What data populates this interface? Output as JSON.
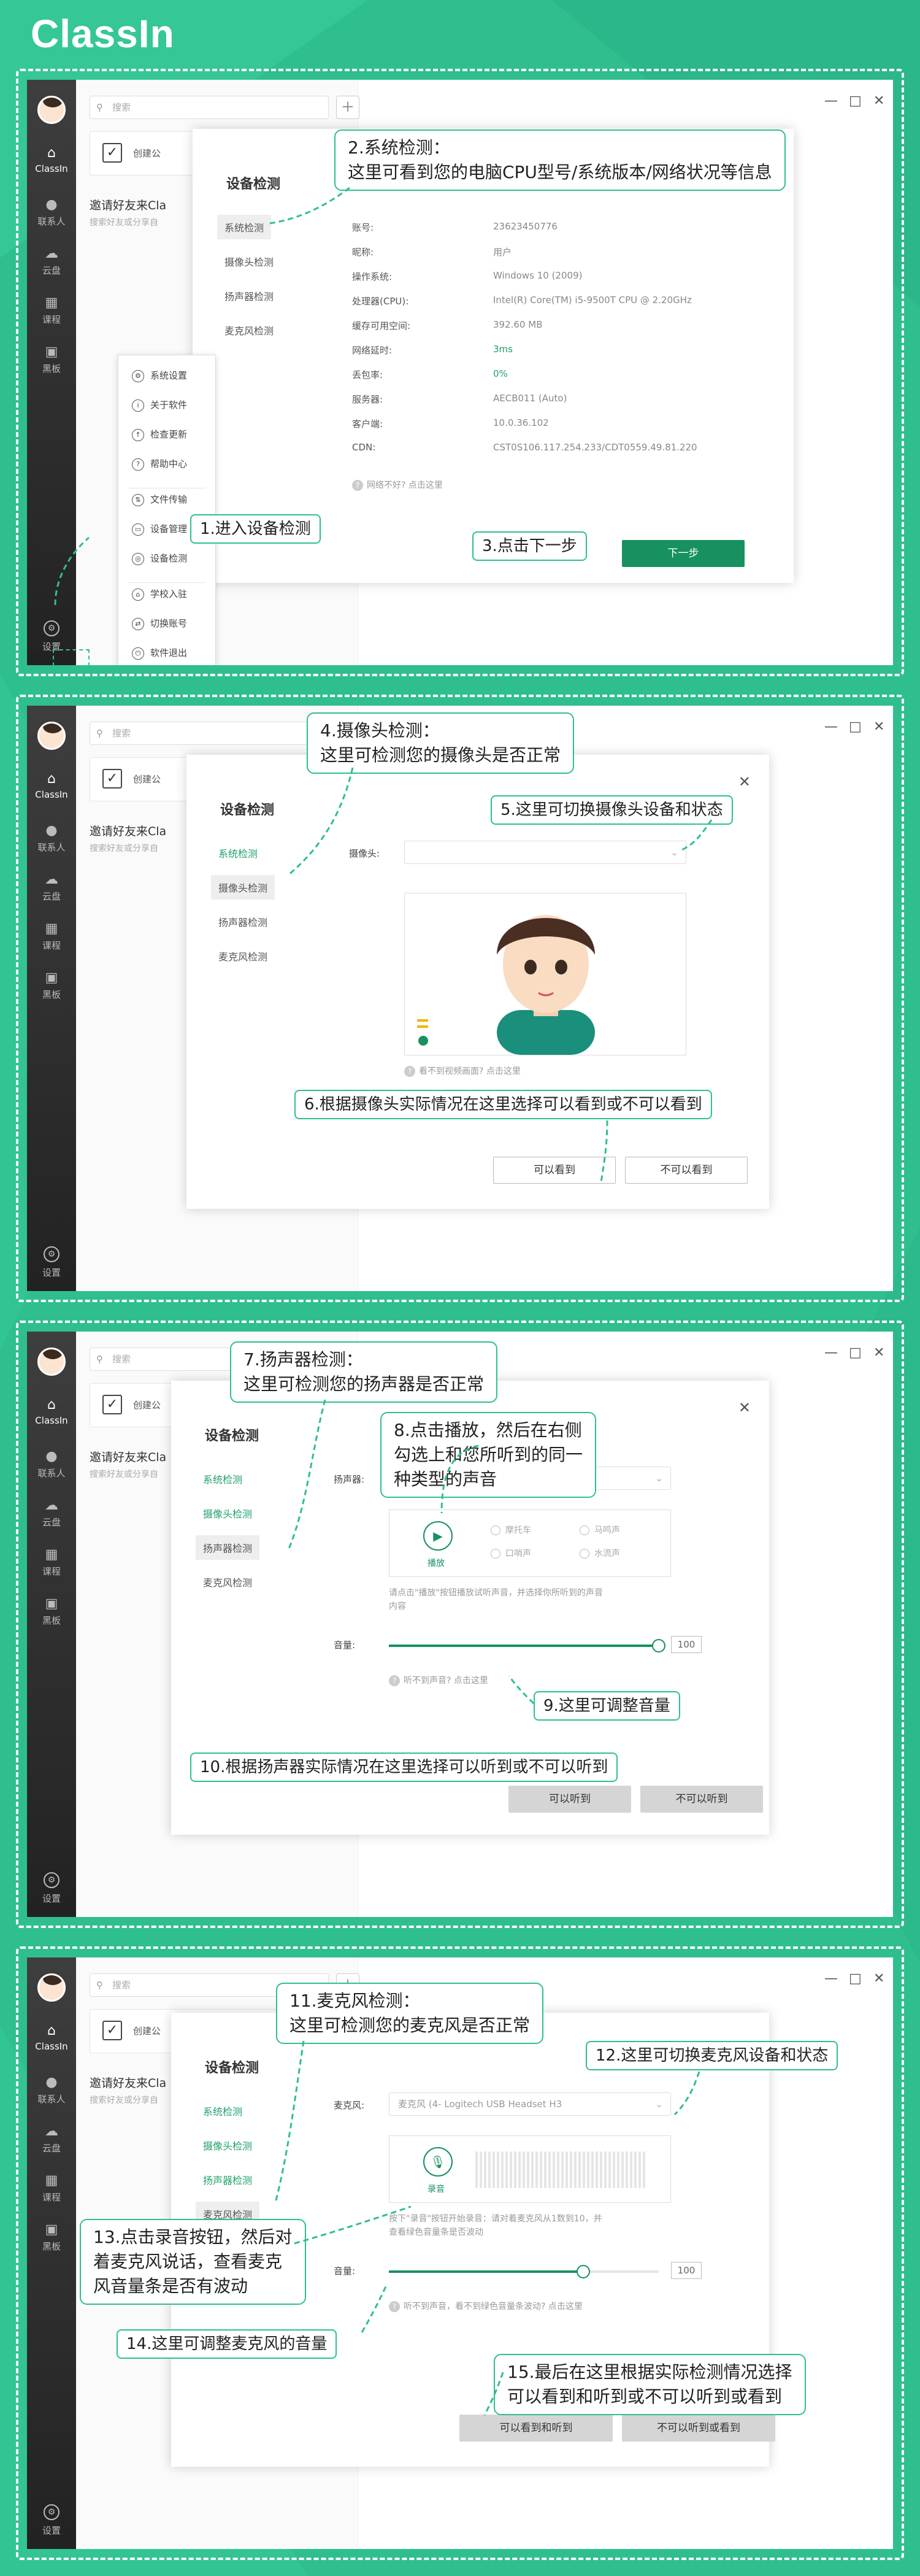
{
  "brand": {
    "logo": "ClassIn"
  },
  "common": {
    "search_placeholder": "搜索",
    "create_label": "创建公",
    "invite_label": "邀请好友来Cla",
    "invite_sub": "搜索好友或分享自",
    "nav": {
      "home": "ClassIn",
      "contacts": "联系人",
      "cloud": "云盘",
      "course": "课程",
      "blackboard": "黑板",
      "settings": "设置"
    },
    "dialog_title": "设备检测",
    "tab_system": "系统检测",
    "tab_camera": "摄像头检测",
    "tab_speaker": "扬声器检测",
    "tab_mic": "麦克风检测"
  },
  "panel1": {
    "menu": [
      "系统设置",
      "关于软件",
      "检查更新",
      "帮助中心",
      "文件传输",
      "设备管理",
      "设备检测",
      "学校入驻",
      "切换账号",
      "软件退出"
    ],
    "info": [
      {
        "k": "账号:",
        "v": "23623450776"
      },
      {
        "k": "昵称:",
        "v": "用户"
      },
      {
        "k": "操作系统:",
        "v": "Windows 10 (2009)"
      },
      {
        "k": "处理器(CPU):",
        "v": "Intel(R) Core(TM) i5-9500T CPU @ 2.20GHz"
      },
      {
        "k": "缓存可用空间:",
        "v": "392.60 MB"
      },
      {
        "k": "网络延时:",
        "v": "3ms"
      },
      {
        "k": "丢包率:",
        "v": "0%"
      },
      {
        "k": "服务器:",
        "v": "AECB011 (Auto)"
      },
      {
        "k": "客户端:",
        "v": "10.0.36.102"
      },
      {
        "k": "CDN:",
        "v": "CST0S106.117.254.233/CDT0559.49.81.220"
      }
    ],
    "hint": "网络不好? 点击这里",
    "next_button": "下一步",
    "callout1": "1.进入设备检测",
    "callout2_line1": "2.系统检测：",
    "callout2_line2": "这里可看到您的电脑CPU型号/系统版本/网络状况等信息",
    "callout3": "3.点击下一步"
  },
  "panel2": {
    "camera_label": "摄像头:",
    "hint": "看不到视频画面? 点击这里",
    "btn_yes": "可以看到",
    "btn_no": "不可以看到",
    "callout4_line1": "4.摄像头检测：",
    "callout4_line2": "这里可检测您的摄像头是否正常",
    "callout5": "5.这里可切换摄像头设备和状态",
    "callout6": "6.根据摄像头实际情况在这里选择可以看到或不可以看到"
  },
  "panel3": {
    "speaker_label": "扬声器:",
    "play_label": "播放",
    "radios": [
      "摩托车",
      "马鸣声",
      "口哨声",
      "水流声"
    ],
    "desc_line1": "请点击\"播放\"按钮播放试听声音，并选择你所听到的声音",
    "desc_line2": "内容",
    "volume_label": "音量:",
    "volume_value": "100",
    "volume_level": 1.0,
    "hint": "听不到声音? 点击这里",
    "btn_yes": "可以听到",
    "btn_no": "不可以听到",
    "callout7_line1": "7.扬声器检测：",
    "callout7_line2": "这里可检测您的扬声器是否正常",
    "callout8_line1": "8.点击播放，然后在右侧",
    "callout8_line2": "勾选上和您所听到的同一",
    "callout8_line3": "种类型的声音",
    "callout9": "9.这里可调整音量",
    "callout10": "10.根据扬声器实际情况在这里选择可以听到或不可以听到"
  },
  "panel4": {
    "mic_label": "麦克风:",
    "mic_value": "麦克风 (4- Logitech USB Headset H3",
    "record_label": "录音",
    "desc_line1": "按下\"录音\"按钮开始录音：请对着麦克风从1数到10，并",
    "desc_line2": "查看绿色音量条是否波动",
    "volume_label": "音量:",
    "volume_value": "100",
    "volume_level": 0.72,
    "hint": "听不到声音，看不到绿色音量条波动? 点击这里",
    "btn_yes": "可以看到和听到",
    "btn_no": "不可以听到或看到",
    "callout11_line1": "11.麦克风检测：",
    "callout11_line2": "这里可检测您的麦克风是否正常",
    "callout12": "12.这里可切换麦克风设备和状态",
    "callout13_line1": "13.点击录音按钮，然后对",
    "callout13_line2": "着麦克风说话，查看麦克",
    "callout13_line3": "风音量条是否有波动",
    "callout14": "14.这里可调整麦克风的音量",
    "callout15_line1": "15.最后在这里根据实际检测情况选择",
    "callout15_line2": "可以看到和听到或不可以听到或看到"
  },
  "colors": {
    "brand_green": "#2fbf8f",
    "button_green": "#16915f",
    "sidebar_dark": "#2d2d2d"
  }
}
